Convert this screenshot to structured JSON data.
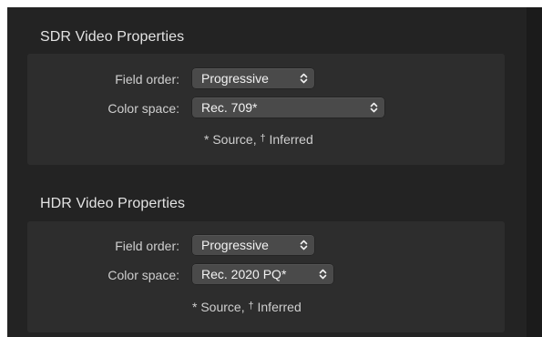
{
  "sdr": {
    "title": "SDR Video Properties",
    "field_order": {
      "label": "Field order:",
      "value": "Progressive"
    },
    "color_space": {
      "label": "Color space:",
      "value": "Rec. 709*"
    },
    "footnote": {
      "source": "* Source,",
      "inferred_symbol": "†",
      "inferred": "Inferred"
    }
  },
  "hdr": {
    "title": "HDR Video Properties",
    "field_order": {
      "label": "Field order:",
      "value": "Progressive"
    },
    "color_space": {
      "label": "Color space:",
      "value": "Rec. 2020 PQ*"
    },
    "footnote": {
      "source": "* Source,",
      "inferred_symbol": "†",
      "inferred": "Inferred"
    }
  },
  "colors": {
    "background": "#232323",
    "panel": "#2d2d2d",
    "popup": "#4a4a4a",
    "text": "#cfcfcf",
    "title": "#e3e3e3"
  },
  "icons": {
    "popup_indicator": "chevron-up-down-icon"
  }
}
